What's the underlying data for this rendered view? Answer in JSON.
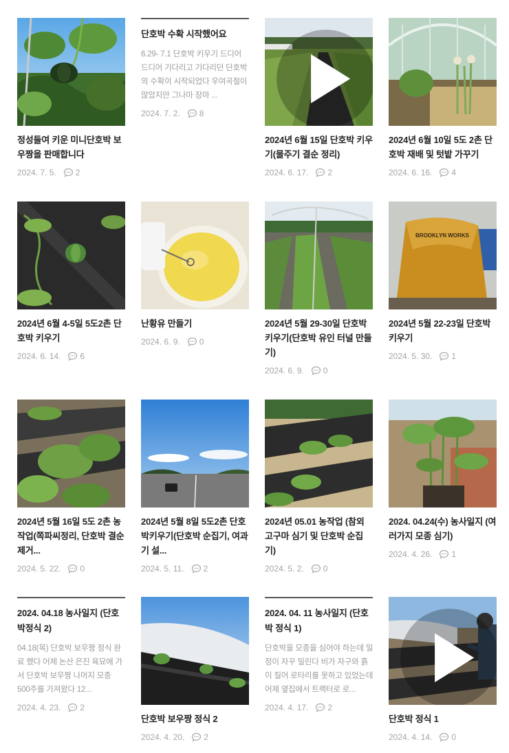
{
  "posts": [
    {
      "title": "정성들여 키운 미니단호박 보우짱을 판매합니다",
      "date": "2024. 7. 5.",
      "comments": "2",
      "thumb": "pumpkin-vine"
    },
    {
      "title": "단호박 수확 시작했어요",
      "excerpt": "6.29- 7.1 단호박 키우기 드디어 드디어 기다리고 기다리던 단호박의 수확이 시작되었다 우여곡절이 많았지만 그나마 장마 ...",
      "date": "2024. 7. 2.",
      "comments": "8"
    },
    {
      "title": "2024년 6월 15일 단호박 키우기(물주기 결순 정리)",
      "date": "2024. 6. 17.",
      "comments": "2",
      "thumb": "field-row",
      "video": true
    },
    {
      "title": "2024년 6월 10일 5도 2촌 단호박 재배 및 텃밭 가꾸기",
      "date": "2024. 6. 16.",
      "comments": "4",
      "thumb": "greenhouse-onion"
    },
    {
      "title": "2024년 6월 4-5일 5도2촌 단호박 키우기",
      "date": "2024. 6. 14.",
      "comments": "6",
      "thumb": "mulch-pumpkin"
    },
    {
      "title": "난황유 만들기",
      "date": "2024. 6. 9.",
      "comments": "0",
      "thumb": "yolk-oil"
    },
    {
      "title": "2024년 5월 29-30일 단호박 키우기(단호박 유인 터널 만들기)",
      "date": "2024. 6. 9.",
      "comments": "0",
      "thumb": "tunnel"
    },
    {
      "title": "2024년 5월 22-23일 단호박 키우기",
      "date": "2024. 5. 30.",
      "comments": "1",
      "thumb": "tent",
      "tent_text": "BROOKLYN WORKS"
    },
    {
      "title": "2024년 5월 16일 5도 2촌 농작업(쪽파씨정리, 단호박 결순 제거...",
      "date": "2024. 5. 22.",
      "comments": "0",
      "thumb": "leaves-rows"
    },
    {
      "title": "2024년 5월 8일 5도2촌 단호박키우기(단호박 순집기, 여과기 설...",
      "date": "2024. 5. 11.",
      "comments": "2",
      "thumb": "highway"
    },
    {
      "title": "2024년 05.01 농작업 (참외 고구마 심기 및 단호박 순집기)",
      "date": "2024. 5. 2.",
      "comments": "0",
      "thumb": "seedlings-mulch"
    },
    {
      "title": "2024. 04.24(수) 농사일지 (여러가지 모종 심기)",
      "date": "2024. 4. 26.",
      "comments": "1",
      "thumb": "tomato"
    },
    {
      "title": "2024. 04.18 농사일지 (단호박정식 2)",
      "excerpt": "04.18(목) 단호박 보우짱 정식 완료 했다 어제 논산 은진 육묘에 가서 단호박 보우짱 나머지 모종 500주를 가져왔다 12...",
      "date": "2024. 4. 23.",
      "comments": "2"
    },
    {
      "title": "단호박 보우짱 정식 2",
      "date": "2024. 4. 20.",
      "comments": "2",
      "thumb": "greenhouse-plastic"
    },
    {
      "title": "2024. 04. 11 농사일지 (단호박 정식 1)",
      "excerpt": "단호박을 모종을 심어야 하는데 일정이 자꾸 밀린다 비가 자구와 흙이 질어 로타리를 못하고 있었는데 어제 옆집에서 트랙터로 로...",
      "date": "2024. 4. 17.",
      "comments": "2"
    },
    {
      "title": "단호박 정식 1",
      "date": "2024. 4. 14.",
      "comments": "0",
      "thumb": "farmer",
      "video": true
    }
  ]
}
